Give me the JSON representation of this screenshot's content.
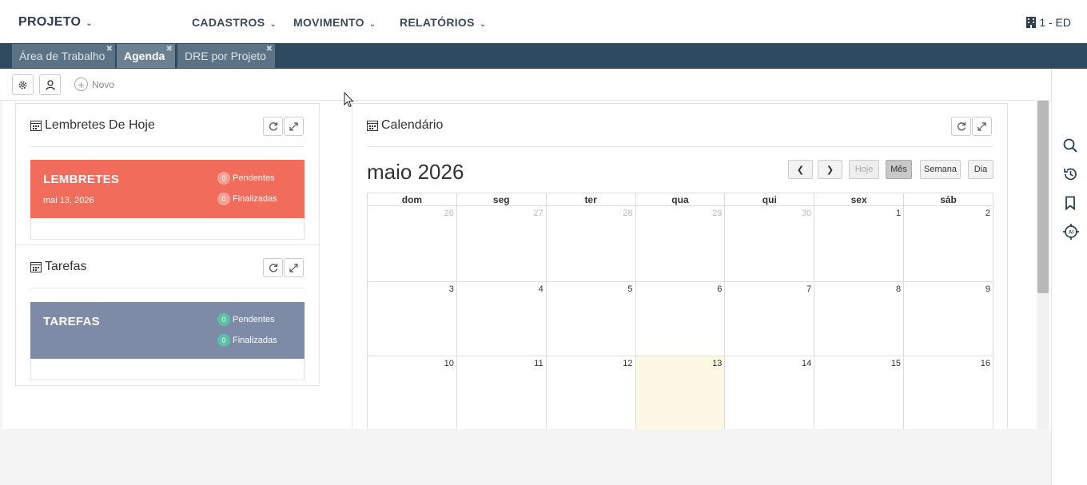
{
  "header": {
    "brand": "PROJETO",
    "menu": [
      "CADASTROS",
      "MOVIMENTO",
      "RELATÓRIOS"
    ],
    "company": "1 - ED"
  },
  "tabs": [
    {
      "label": "Área de Trabalho",
      "active": false
    },
    {
      "label": "Agenda",
      "active": true
    },
    {
      "label": "DRE por Projeto",
      "active": false
    }
  ],
  "toolbar": {
    "new_label": "Novo"
  },
  "reminders": {
    "title": "Lembretes De Hoje",
    "card_title": "LEMBRETES",
    "date": "mai 13, 2026",
    "pending_count": "0",
    "pending_label": "Pendentes",
    "done_count": "0",
    "done_label": "Finalizadas",
    "color": "#f26c5c"
  },
  "tasks": {
    "title": "Tarefas",
    "card_title": "TAREFAS",
    "pending_count": "0",
    "pending_label": "Pendentes",
    "done_count": "0",
    "done_label": "Finalizadas",
    "color": "#7e8ba6"
  },
  "calendar": {
    "title": "Calendário",
    "month_label": "maio 2026",
    "buttons": {
      "today": "Hoje",
      "month": "Mês",
      "week": "Semana",
      "day": "Dia"
    },
    "weekdays": [
      "dom",
      "seg",
      "ter",
      "qua",
      "qui",
      "sex",
      "sáb"
    ],
    "weeks": [
      [
        "26",
        "27",
        "28",
        "29",
        "30",
        "1",
        "2"
      ],
      [
        "3",
        "4",
        "5",
        "6",
        "7",
        "8",
        "9"
      ],
      [
        "10",
        "11",
        "12",
        "13",
        "14",
        "15",
        "16"
      ]
    ],
    "other_month_days": 5,
    "today": "13",
    "today_color": "#fcf8e3"
  }
}
